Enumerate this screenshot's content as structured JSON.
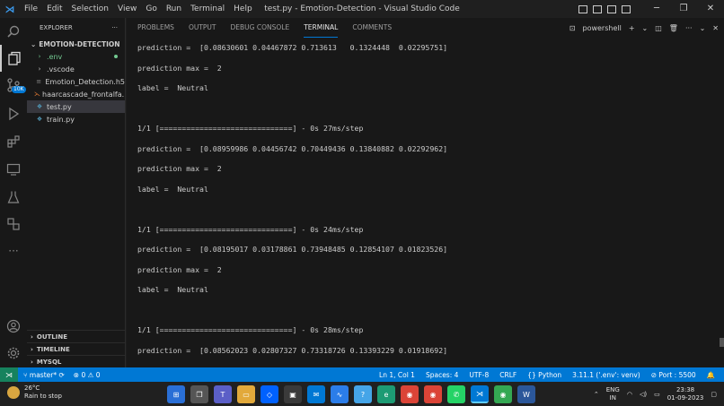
{
  "window": {
    "title": "test.py - Emotion-Detection - Visual Studio Code",
    "menu": [
      "File",
      "Edit",
      "Selection",
      "View",
      "Go",
      "Run",
      "Terminal",
      "Help"
    ]
  },
  "activity_bar": {
    "source_control_badge": "10K",
    "icons": [
      "explorer-icon",
      "search-icon",
      "source-control-icon",
      "run-debug-icon",
      "extensions-icon",
      "remote-explorer-icon",
      "testing-icon",
      "docker-icon",
      "more-icon",
      "account-icon",
      "settings-gear-icon"
    ]
  },
  "explorer": {
    "header": "EXPLORER",
    "folder": "EMOTION-DETECTION",
    "items": [
      {
        "label": ".env",
        "icon": "chevron-right",
        "color": "#73c991",
        "modified": true
      },
      {
        "label": ".vscode",
        "icon": "chevron-right",
        "color": "#cccccc"
      },
      {
        "label": "Emotion_Detection.h5",
        "icon": "file",
        "color": "#cccccc"
      },
      {
        "label": "haarcascade_frontalfa...",
        "icon": "xml",
        "color": "#cccccc"
      },
      {
        "label": "test.py",
        "icon": "python",
        "color": "#cccccc",
        "selected": true
      },
      {
        "label": "train.py",
        "icon": "python",
        "color": "#cccccc"
      }
    ],
    "sections": [
      "OUTLINE",
      "TIMELINE",
      "MYSQL"
    ]
  },
  "panel": {
    "tabs": [
      "PROBLEMS",
      "OUTPUT",
      "DEBUG CONSOLE",
      "TERMINAL",
      "COMMENTS"
    ],
    "active_tab": "TERMINAL",
    "shell": "powershell",
    "terminal_lines": [
      "prediction =  [0.08630601 0.04467872 0.713613   0.1324448  0.02295751]",
      "prediction max =  2",
      "label =  Neutral",
      "",
      "1/1 [==============================] - 0s 27ms/step",
      "prediction =  [0.08959986 0.04456742 0.70449436 0.13840882 0.02292962]",
      "prediction max =  2",
      "label =  Neutral",
      "",
      "1/1 [==============================] - 0s 24ms/step",
      "prediction =  [0.08195017 0.03178861 0.73948485 0.12854107 0.01823526]",
      "prediction max =  2",
      "label =  Neutral",
      "",
      "1/1 [==============================] - 0s 28ms/step",
      "prediction =  [0.08562023 0.02807327 0.73318726 0.13393229 0.01918692]"
    ]
  },
  "statusbar": {
    "branch": "master*",
    "errors": "0",
    "warnings": "0",
    "position": "Ln 1, Col 1",
    "spaces": "Spaces: 4",
    "encoding": "UTF-8",
    "eol": "CRLF",
    "language": "Python",
    "interpreter": "3.11.1 ('.env': venv)",
    "port": "Port : 5500"
  },
  "taskbar": {
    "temperature": "26°C",
    "weather": "Rain to stop",
    "language": "ENG",
    "region": "IN",
    "time": "23:38",
    "date": "01-09-2023"
  }
}
